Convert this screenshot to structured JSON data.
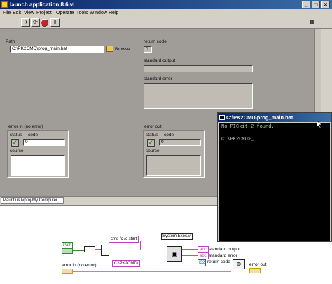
{
  "window": {
    "title": "launch application 8.6.vi"
  },
  "menu": [
    "File",
    "Edit",
    "View",
    "Project",
    "Operate",
    "Tools",
    "Window",
    "Help"
  ],
  "panel": {
    "path_label": "Path",
    "path_value": "C:\\PK2CMD\\prog_main.bat",
    "browse_label": "Browse",
    "return_code_label": "return code",
    "return_code_value": "0",
    "standard_output_label": "standard output",
    "standard_error_label": "standard error",
    "error_in": {
      "title": "error in (no error)",
      "status_label": "status",
      "code_label": "code",
      "code_value": "0",
      "source_label": "source"
    },
    "error_out": {
      "title": "error out",
      "status_label": "status",
      "code_label": "code",
      "code_value": "0",
      "source_label": "source"
    },
    "project_tab": "Mauritius.lvproj/My Computer"
  },
  "console": {
    "title": "C:\\PK2CMD\\prog_main.bat",
    "line1": "No PICkit 2 found.",
    "line2": "C:\\PK2CMD>_"
  },
  "diagram": {
    "path_node": "Path",
    "cmd_string": "cmd /c /c start",
    "cmd_dir": "C:\\PK2CMD\\",
    "system_exec": "System Exec.vi",
    "standard_output": "standard output",
    "standard_error": "standard error",
    "return_code": "return code",
    "error_in": "error in (no error)",
    "error_out": "error out",
    "abc1": "abc",
    "abc2": "abc",
    "i32": "I32"
  }
}
